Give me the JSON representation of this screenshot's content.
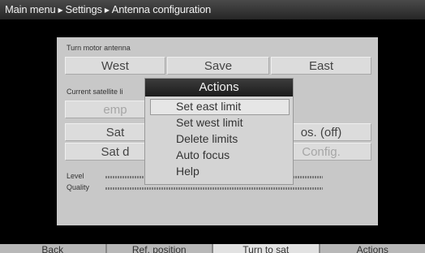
{
  "breadcrumb": [
    "Main menu",
    "Settings",
    "Antenna configuration"
  ],
  "motor": {
    "label": "Turn motor antenna",
    "west": "West",
    "save": "Save",
    "east": "East"
  },
  "satellite": {
    "label": "Current satellite li",
    "value": "emp",
    "sat_btn": "Sat",
    "pos_btn": "os. (off)",
    "sat2_btn": "Sat d",
    "config_btn": "Config."
  },
  "meters": {
    "level_label": "Level",
    "quality_label": "Quality"
  },
  "actions_popup": {
    "title": "Actions",
    "items": [
      "Set east limit",
      "Set west limit",
      "Delete limits",
      "Auto focus",
      "Help"
    ],
    "selected_index": 0
  },
  "footer": {
    "tabs": [
      "Back",
      "Ref. position",
      "Turn to sat",
      "Actions"
    ],
    "active_index": 2
  }
}
